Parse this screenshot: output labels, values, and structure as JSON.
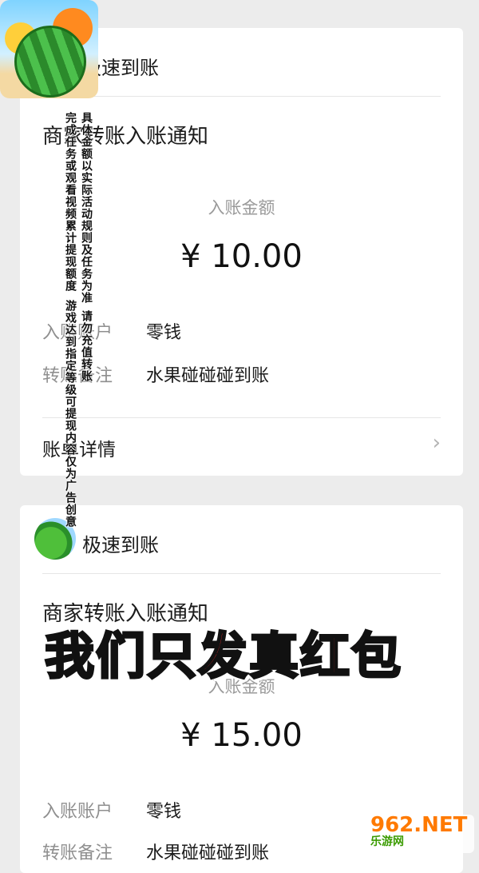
{
  "card1": {
    "header_title": "极速到账",
    "notice_title": "商家转账入账通知",
    "amount_label": "入账金额",
    "amount": "¥ 10.00",
    "account_label": "入账账户",
    "account_value": "零钱",
    "remark_label": "转账备注",
    "remark_value": "水果碰碰碰到账",
    "detail_label": "账单详情",
    "chevron": "›"
  },
  "card2": {
    "header_title": "极速到账",
    "notice_title": "商家转账入账通知",
    "amount_label": "入账金额",
    "amount": "¥ 15.00",
    "account_label": "入账账户",
    "account_value": "零钱",
    "remark_label": "转账备注",
    "remark_value": "水果碰碰碰到账"
  },
  "overlay": {
    "v1": "完成任务或观看视频累计提现额度",
    "v2": "游戏达到指定等级可提现",
    "v3": "具体金额以实际活动规则及任务为准",
    "v4": "请勿充值转账",
    "v5": "内容仅为广告创意",
    "banner_part1": "我们",
    "banner_part2": "只发真红包"
  },
  "watermark": {
    "top": "962.NET",
    "bottom": "乐游网"
  }
}
